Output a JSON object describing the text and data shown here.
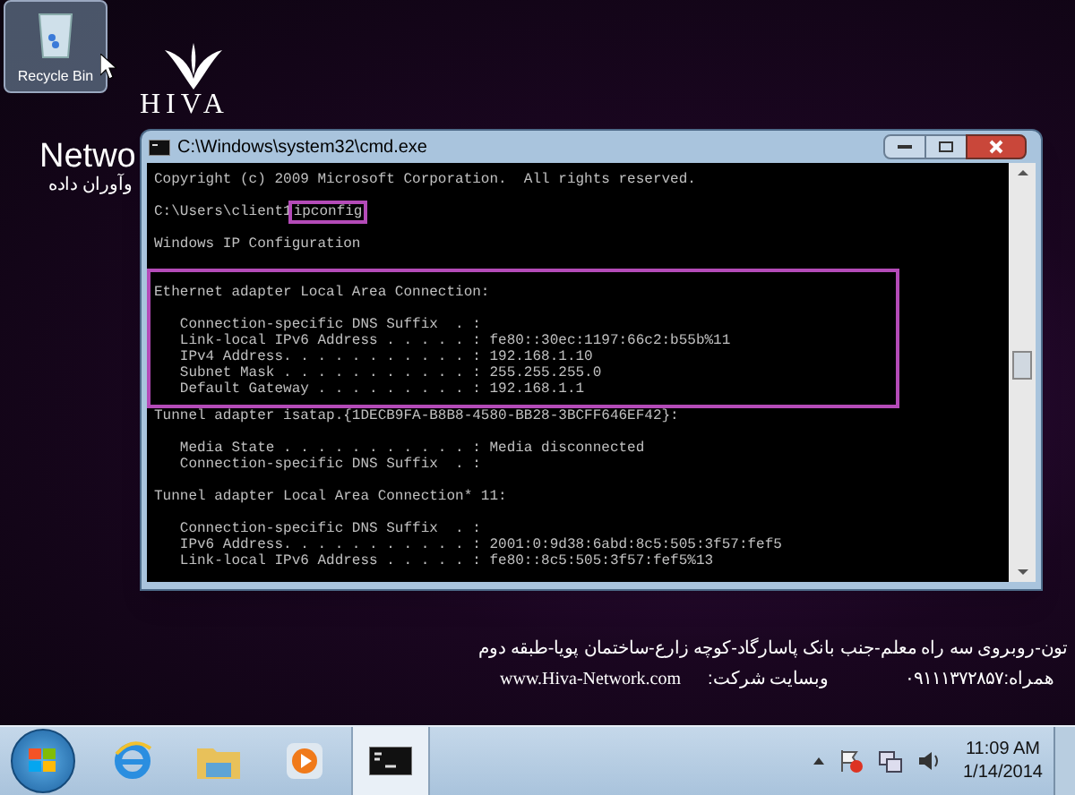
{
  "desktop": {
    "icons": [
      {
        "label": "Recycle Bin",
        "selected": true
      }
    ],
    "wallpaper": {
      "logo_text": "HIVA",
      "heading": "Netwo",
      "subheading": "وآوران داده",
      "address": "تون-روبروی سه راه معلم-جنب بانک پاسارگاد-کوچه زارع-ساختمان پویا-طبقه دوم",
      "website": "www.Hiva-Network.com",
      "website_label": "وبسایت شرکت:",
      "phone": "همراه:۰۹۱۱۱۳۷۲۸۵۷"
    }
  },
  "window": {
    "title": "C:\\Windows\\system32\\cmd.exe",
    "sections": [
      {
        "highlighted": false,
        "lines": [
          {
            "kind": "text",
            "text": "Copyright (c) 2009 Microsoft Corporation.  All rights reserved."
          },
          {
            "kind": "blank"
          },
          {
            "kind": "prompt",
            "prompt": "C:\\Users\\client1",
            "command": "ipconfig",
            "highlighted": true
          },
          {
            "kind": "blank"
          },
          {
            "kind": "text",
            "text": "Windows IP Configuration"
          },
          {
            "kind": "blank"
          }
        ]
      },
      {
        "highlighted": true,
        "lines": [
          {
            "kind": "text",
            "text": "Ethernet adapter Local Area Connection:"
          },
          {
            "kind": "blank"
          },
          {
            "kind": "text",
            "text": "   Connection-specific DNS Suffix  . :"
          },
          {
            "kind": "text",
            "text": "   Link-local IPv6 Address . . . . . : fe80::30ec:1197:66c2:b55b%11"
          },
          {
            "kind": "text",
            "text": "   IPv4 Address. . . . . . . . . . . : 192.168.1.10"
          },
          {
            "kind": "text",
            "text": "   Subnet Mask . . . . . . . . . . . : 255.255.255.0"
          },
          {
            "kind": "text",
            "text": "   Default Gateway . . . . . . . . . : 192.168.1.1"
          }
        ]
      },
      {
        "highlighted": false,
        "lines": [
          {
            "kind": "text",
            "text": "Tunnel adapter isatap.{1DECB9FA-B8B8-4580-BB28-3BCFF646EF42}:"
          },
          {
            "kind": "blank"
          },
          {
            "kind": "text",
            "text": "   Media State . . . . . . . . . . . : Media disconnected"
          },
          {
            "kind": "text",
            "text": "   Connection-specific DNS Suffix  . :"
          },
          {
            "kind": "blank"
          },
          {
            "kind": "text",
            "text": "Tunnel adapter Local Area Connection* 11:"
          },
          {
            "kind": "blank"
          },
          {
            "kind": "text",
            "text": "   Connection-specific DNS Suffix  . :"
          },
          {
            "kind": "text",
            "text": "   IPv6 Address. . . . . . . . . . . : 2001:0:9d38:6abd:8c5:505:3f57:fef5"
          },
          {
            "kind": "text",
            "text": "   Link-local IPv6 Address . . . . . : fe80::8c5:505:3f57:fef5%13"
          }
        ]
      }
    ]
  },
  "taskbar": {
    "apps": [
      {
        "kind": "browser",
        "selected": false
      },
      {
        "kind": "folder",
        "selected": false
      },
      {
        "kind": "media",
        "selected": false
      },
      {
        "kind": "console",
        "selected": true
      }
    ],
    "clock": {
      "time": "11:09 AM",
      "date": "1/14/2014"
    }
  }
}
